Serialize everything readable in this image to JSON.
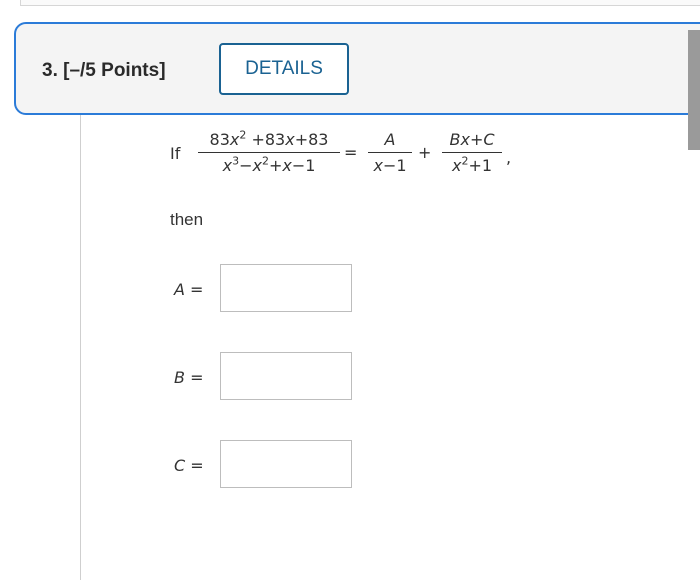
{
  "question": {
    "number_points": "3.  [–/5 Points]",
    "details_label": "DETAILS"
  },
  "equation": {
    "if_word": "If",
    "lhs_num": [
      "83",
      "x",
      "2",
      " +83",
      "x",
      "+83"
    ],
    "lhs_den": [
      "x",
      "3",
      "−",
      "x",
      "2",
      "+",
      "x",
      "−1"
    ],
    "eq": "=",
    "t1_num": "A",
    "t1_den": [
      "x",
      "−1"
    ],
    "plus": "+",
    "t2_num": [
      "B",
      "x",
      "+",
      "C"
    ],
    "t2_den": [
      "x",
      "2",
      "+1"
    ],
    "comma": ","
  },
  "then_word": "then",
  "answers": [
    {
      "label": "A",
      "eq": " =",
      "value": ""
    },
    {
      "label": "B",
      "eq": " =",
      "value": ""
    },
    {
      "label": "C",
      "eq": " =",
      "value": ""
    }
  ]
}
